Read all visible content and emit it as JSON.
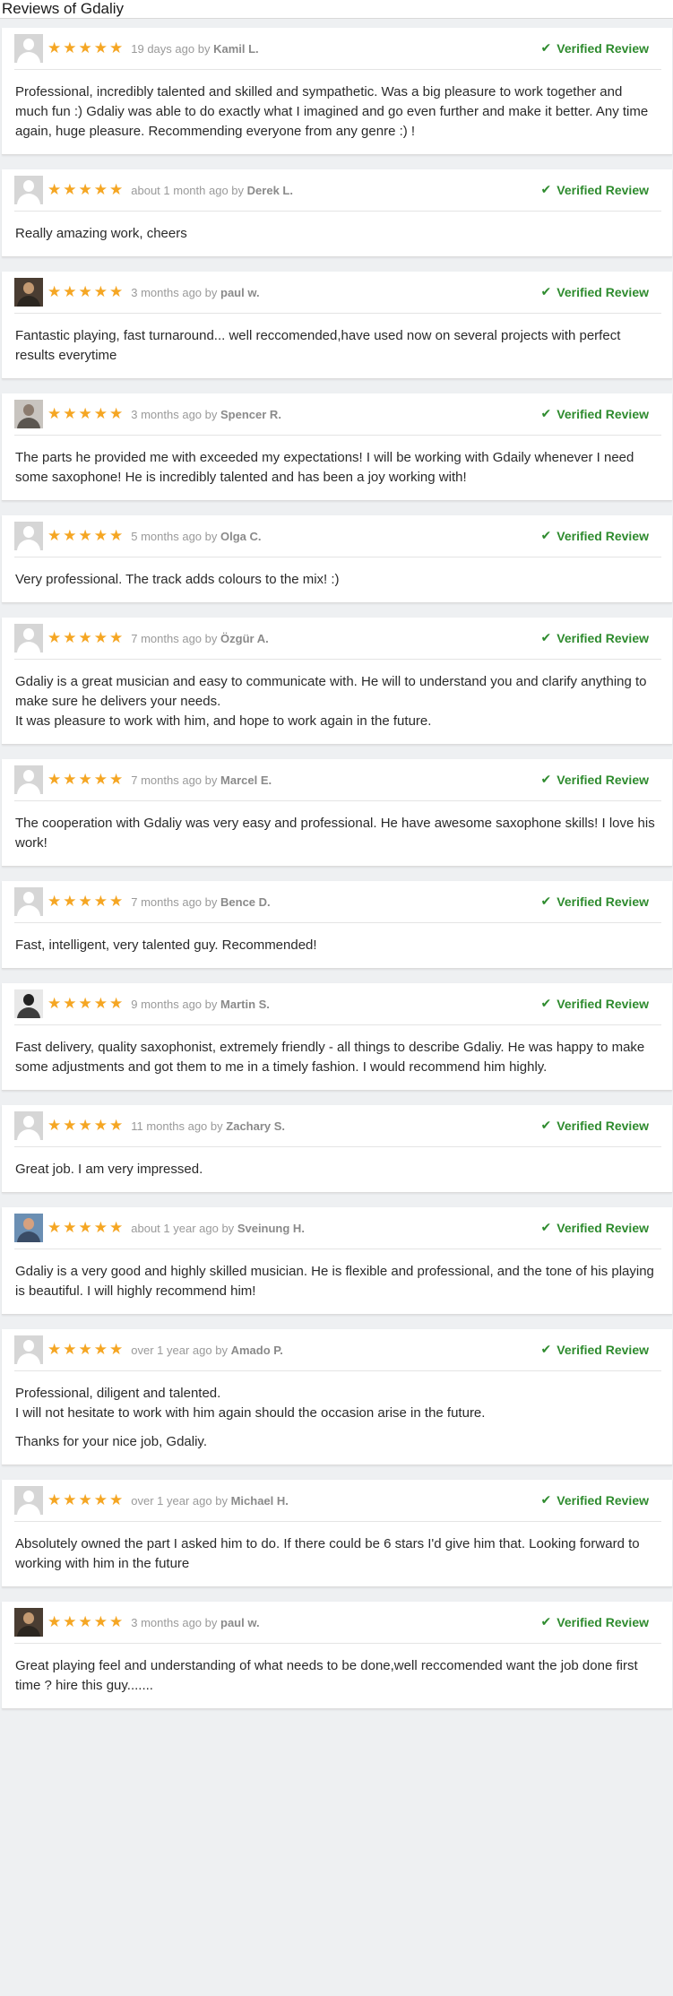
{
  "page": {
    "title": "Reviews of Gdaliy"
  },
  "verified_label": "Verified Review",
  "colors": {
    "star": "#f5a623",
    "verified": "#2e8b2e"
  },
  "reviews": [
    {
      "time": "19 days ago",
      "by": "by",
      "name": "Kamil L.",
      "rating": 5,
      "avatar": "default",
      "paragraphs": [
        "Professional, incredibly talented and skilled and sympathetic. Was a big pleasure to work together and much fun :) Gdaliy was able to do exactly what I imagined and go even further and make it better. Any time again, huge pleasure. Recommending everyone from any genre :) !"
      ]
    },
    {
      "time": "about 1 month ago",
      "by": "by",
      "name": "Derek L.",
      "rating": 5,
      "avatar": "default",
      "paragraphs": [
        "Really amazing work, cheers"
      ]
    },
    {
      "time": "3 months ago",
      "by": "by",
      "name": "paul w.",
      "rating": 5,
      "avatar": "photo",
      "paragraphs": [
        "Fantastic playing, fast turnaround... well reccomended,have used now on several projects with perfect results everytime"
      ]
    },
    {
      "time": "3 months ago",
      "by": "by",
      "name": "Spencer R.",
      "rating": 5,
      "avatar": "photo-light",
      "paragraphs": [
        "The parts he provided me with exceeded my expectations! I will be working with Gdaily whenever I need some saxophone! He is incredibly talented and has been a joy working with!"
      ]
    },
    {
      "time": "5 months ago",
      "by": "by",
      "name": "Olga C.",
      "rating": 5,
      "avatar": "default",
      "paragraphs": [
        "Very professional. The track adds colours to the mix! :)"
      ]
    },
    {
      "time": "7 months ago",
      "by": "by",
      "name": "Özgür A.",
      "rating": 5,
      "avatar": "default",
      "paragraphs": [
        "Gdaliy is a great musician and easy to communicate with. He will to understand you and clarify anything to make sure he delivers your needs.",
        "It was pleasure to work with him, and hope to work again in the future."
      ]
    },
    {
      "time": "7 months ago",
      "by": "by",
      "name": "Marcel E.",
      "rating": 5,
      "avatar": "default",
      "paragraphs": [
        "The cooperation with Gdaliy was very easy and professional. He have awesome saxophone skills! I love his work!"
      ]
    },
    {
      "time": "7 months ago",
      "by": "by",
      "name": "Bence D.",
      "rating": 5,
      "avatar": "default",
      "paragraphs": [
        "Fast, intelligent, very talented guy. Recommended!"
      ]
    },
    {
      "time": "9 months ago",
      "by": "by",
      "name": "Martin S.",
      "rating": 5,
      "avatar": "photo-bw",
      "paragraphs": [
        "Fast delivery, quality saxophonist, extremely friendly - all things to describe Gdaliy. He was happy to make some adjustments and got them to me in a timely fashion. I would recommend him highly."
      ]
    },
    {
      "time": "11 months ago",
      "by": "by",
      "name": "Zachary S.",
      "rating": 5,
      "avatar": "default",
      "paragraphs": [
        "Great job. I am very impressed."
      ]
    },
    {
      "time": "about 1 year ago",
      "by": "by",
      "name": "Sveinung H.",
      "rating": 5,
      "avatar": "photo-blue",
      "paragraphs": [
        "Gdaliy is a very good and highly skilled musician. He is flexible and professional, and the tone of his playing is beautiful. I will highly recommend him!"
      ]
    },
    {
      "time": "over 1 year ago",
      "by": "by",
      "name": "Amado P.",
      "rating": 5,
      "avatar": "default",
      "paragraphs": [
        "Professional, diligent and talented.",
        "I will not hesitate to work with him again should the occasion arise in the future.",
        "Thanks for your nice job, Gdaliy."
      ],
      "gap_before_last": true
    },
    {
      "time": "over 1 year ago",
      "by": "by",
      "name": "Michael H.",
      "rating": 5,
      "avatar": "default",
      "paragraphs": [
        "Absolutely owned the part I asked him to do. If there could be 6 stars I'd give him that. Looking forward to working with him in the future"
      ]
    },
    {
      "time": "3 months ago",
      "by": "by",
      "name": "paul w.",
      "rating": 5,
      "avatar": "photo",
      "paragraphs": [
        "Great playing feel and understanding of what needs to be done,well reccomended want the job done first time ? hire this guy......."
      ]
    }
  ]
}
